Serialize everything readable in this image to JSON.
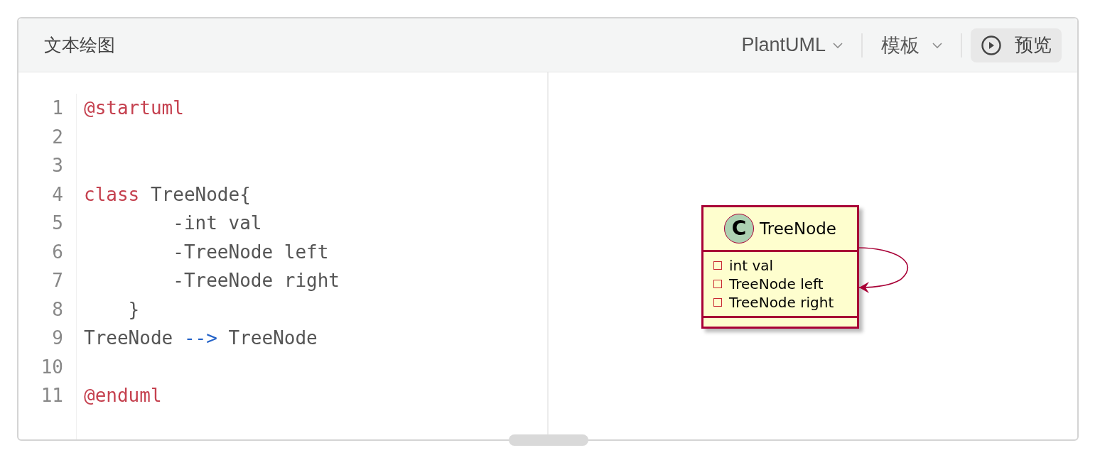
{
  "header": {
    "title": "文本绘图",
    "language_menu": {
      "label": "PlantUML"
    },
    "template_menu": {
      "label": "模板"
    },
    "preview_button": {
      "label": "预览"
    }
  },
  "editor": {
    "lines": [
      {
        "number": "1",
        "tokens": [
          {
            "kind": "keyword",
            "text": "@startuml"
          }
        ]
      },
      {
        "number": "2"
      },
      {
        "number": "3"
      },
      {
        "number": "4",
        "tokens": [
          {
            "kind": "keyword",
            "text": "class"
          },
          {
            "kind": "plain",
            "text": " TreeNode{"
          }
        ]
      },
      {
        "number": "5",
        "tokens": [
          {
            "kind": "plain",
            "text": "        -int val"
          }
        ]
      },
      {
        "number": "6",
        "tokens": [
          {
            "kind": "plain",
            "text": "        -TreeNode left"
          }
        ]
      },
      {
        "number": "7",
        "tokens": [
          {
            "kind": "plain",
            "text": "        -TreeNode right"
          }
        ]
      },
      {
        "number": "8",
        "tokens": [
          {
            "kind": "plain",
            "text": "    }"
          }
        ]
      },
      {
        "number": "9",
        "tokens": [
          {
            "kind": "plain",
            "text": "TreeNode "
          },
          {
            "kind": "arrow",
            "text": "-->"
          },
          {
            "kind": "plain",
            "text": " TreeNode"
          }
        ]
      },
      {
        "number": "10"
      },
      {
        "number": "11",
        "tokens": [
          {
            "kind": "keyword",
            "text": "@enduml"
          }
        ]
      }
    ]
  },
  "preview": {
    "class": {
      "stereotype": "C",
      "name": "TreeNode",
      "fields": [
        {
          "kind": "private",
          "text": "int val"
        },
        {
          "kind": "private",
          "text": "TreeNode left"
        },
        {
          "kind": "private",
          "text": "TreeNode right"
        }
      ],
      "self_association": true
    }
  }
}
